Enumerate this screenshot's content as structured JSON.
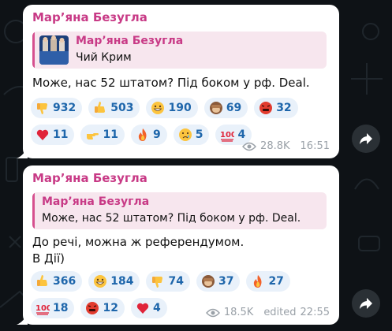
{
  "messages": [
    {
      "author": "Мар’яна Безугла",
      "reply": {
        "author": "Мар’яна Безугла",
        "text": "Чий Крим"
      },
      "text_lines": [
        "Може, нас 52 штатом? Під боком у рф. Deal."
      ],
      "reactions": [
        [
          {
            "emoji": "thumbs-down",
            "count": "932"
          },
          {
            "emoji": "thumbs-up",
            "count": "503"
          },
          {
            "emoji": "grinning-face",
            "count": "190"
          },
          {
            "emoji": "see-no-evil-monkey",
            "count": "69"
          },
          {
            "emoji": "angry-face-symbols",
            "count": "32"
          }
        ],
        [
          {
            "emoji": "red-heart",
            "count": "11"
          },
          {
            "emoji": "pointing-hand",
            "count": "11"
          },
          {
            "emoji": "fire",
            "count": "9"
          },
          {
            "emoji": "crying-face",
            "count": "5"
          },
          {
            "emoji": "hundred-points",
            "count": "4"
          }
        ]
      ],
      "views": "28.8K",
      "time": "16:51",
      "edited": ""
    },
    {
      "author": "Мар’яна Безугла",
      "reply": {
        "author": "Мар’яна Безугла",
        "text": "Може, нас 52 штатом? Під боком у рф. Deal."
      },
      "text_lines": [
        "До речі, можна ж референдумом.",
        "В Дії)"
      ],
      "reactions": [
        [
          {
            "emoji": "thumbs-up",
            "count": "366"
          },
          {
            "emoji": "grinning-face",
            "count": "184"
          },
          {
            "emoji": "thumbs-down",
            "count": "74"
          },
          {
            "emoji": "see-no-evil-monkey",
            "count": "37"
          },
          {
            "emoji": "fire",
            "count": "27"
          }
        ],
        [
          {
            "emoji": "hundred-points",
            "count": "18"
          },
          {
            "emoji": "angry-face-symbols",
            "count": "12"
          },
          {
            "emoji": "red-heart",
            "count": "4"
          }
        ]
      ],
      "views": "18.5K",
      "time": "22:55",
      "edited": "edited"
    }
  ],
  "colors": {
    "author": "#c83a86",
    "reaction_bg": "#e9f1fa",
    "reaction_text": "#1e66ab",
    "meta": "#9aa1a8",
    "background": "#0e1216"
  },
  "icons": [
    "eye-icon",
    "forward-arrow-icon"
  ]
}
